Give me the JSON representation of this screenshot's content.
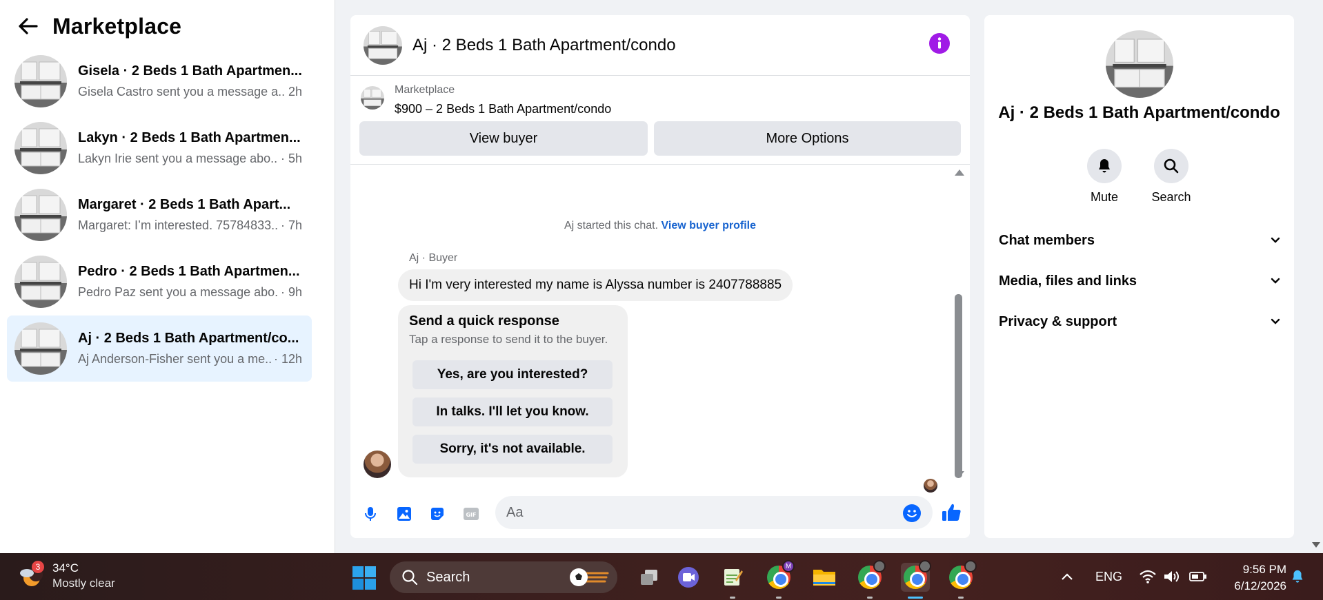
{
  "sidebar": {
    "title": "Marketplace",
    "conversations": [
      {
        "name": "Gisela · 2 Beds 1 Bath Apartmen...",
        "preview": "Gisela Castro sent you a message a...",
        "time": "2h"
      },
      {
        "name": "Lakyn · 2 Beds 1 Bath Apartmen...",
        "preview": "Lakyn Irie sent you a message abo...",
        "time": "· 5h"
      },
      {
        "name": "Margaret · 2 Beds 1 Bath Apart...",
        "preview": "Margaret: I’m interested. 75784833...",
        "time": "· 7h"
      },
      {
        "name": "Pedro · 2 Beds 1 Bath Apartmen...",
        "preview": "Pedro Paz sent you a message abo...",
        "time": "· 9h"
      },
      {
        "name": "Aj · 2 Beds 1 Bath Apartment/co...",
        "preview": "Aj Anderson-Fisher sent you a me...",
        "time": "· 12h"
      }
    ]
  },
  "chat": {
    "header_title": "Aj · 2 Beds 1 Bath Apartment/condo",
    "listing": {
      "source": "Marketplace",
      "title": "$900 – 2 Beds 1 Bath Apartment/condo",
      "view_buyer": "View buyer",
      "more_options": "More Options"
    },
    "system": {
      "text": "Aj started this chat. ",
      "link": "View buyer profile"
    },
    "sender_label": "Aj · Buyer",
    "message": "Hi I'm very interested my name is Alyssa number is 2407788885",
    "quick_response": {
      "title": "Send a quick response",
      "subtitle": "Tap a response to send it to the buyer.",
      "options": [
        "Yes, are you interested?",
        "In talks. I'll let you know.",
        "Sorry, it's not available."
      ]
    },
    "composer": {
      "placeholder": "Aa"
    }
  },
  "details": {
    "title": "Aj · 2 Beds 1 Bath Apartment/condo",
    "actions": [
      {
        "label": "Mute",
        "icon": "bell-icon"
      },
      {
        "label": "Search",
        "icon": "search-icon"
      }
    ],
    "sections": [
      "Chat members",
      "Media, files and links",
      "Privacy & support"
    ]
  },
  "taskbar": {
    "weather": {
      "temp": "34°C",
      "desc": "Mostly clear",
      "badge": "3"
    },
    "search_label": "Search",
    "language": "ENG",
    "time": "9:56 PM",
    "date": "6/12/2026",
    "chrome_badge": "M"
  },
  "colors": {
    "accent": "#0866ff",
    "info": "#a01be6",
    "active_row": "#e7f3ff"
  }
}
